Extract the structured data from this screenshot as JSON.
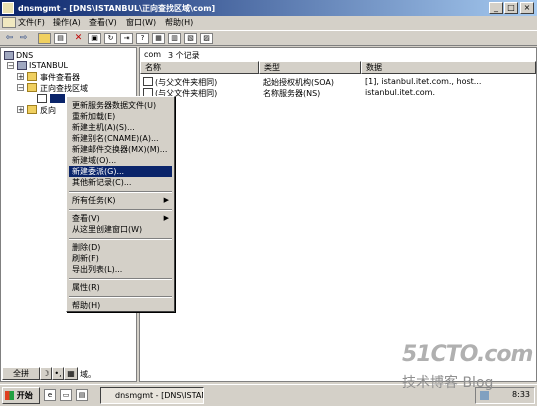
{
  "window": {
    "title": "dnsmgmt - [DNS\\ISTANBUL\\正向查找区域\\com]"
  },
  "titlebar_buttons": {
    "minimize": "_",
    "maximize": "□",
    "close": "×"
  },
  "menu": [
    "文件(F)",
    "操作(A)",
    "查看(V)",
    "窗口(W)",
    "帮助(H)"
  ],
  "tree": {
    "root": "DNS",
    "server": "ISTANBUL",
    "event_viewer": "事件查看器",
    "forward_zone": "正向查找区域",
    "reverse_zone": "反向"
  },
  "list": {
    "header_zone": "com",
    "header_count": "3 个记录",
    "columns": [
      "名称",
      "类型",
      "数据"
    ],
    "rows": [
      {
        "name": "(与父文件夹相同)",
        "type": "起始授权机构(SOA)",
        "data": "[1], istanbul.itet.com., host..."
      },
      {
        "name": "(与父文件夹相同)",
        "type": "名称服务器(NS)",
        "data": "istanbul.itet.com."
      }
    ]
  },
  "context_menu": {
    "items": [
      {
        "label": "更新服务器数据文件(U)"
      },
      {
        "label": "重新加载(E)"
      },
      {
        "label": "新建主机(A)(S)..."
      },
      {
        "label": "新建别名(CNAME)(A)..."
      },
      {
        "label": "新建邮件交换器(MX)(M)..."
      },
      {
        "label": "新建域(O)..."
      },
      {
        "label": "新建委派(G)...",
        "selected": true
      },
      {
        "label": "其他新记录(C)..."
      },
      {
        "label": "所有任务(K)",
        "submenu": true
      },
      {
        "label": "查看(V)",
        "submenu": true
      },
      {
        "label": "从这里创建窗口(W)"
      },
      {
        "label": "删除(D)"
      },
      {
        "label": "刷新(F)"
      },
      {
        "label": "导出列表(L)..."
      },
      {
        "label": "属性(R)"
      },
      {
        "label": "帮助(H)"
      }
    ]
  },
  "statusbar": {
    "ime_label": "全拼",
    "ime_moon": "☽",
    "ime_dot": "•,",
    "ime_kb": "▦",
    "tail": "域。"
  },
  "taskbar": {
    "start": "开始",
    "task": "dnsmgmt - [DNS\\ISTANB...",
    "clock": "8:33"
  },
  "watermark": {
    "line1": "51CTO.com",
    "line2": "技术博客  Blog"
  }
}
